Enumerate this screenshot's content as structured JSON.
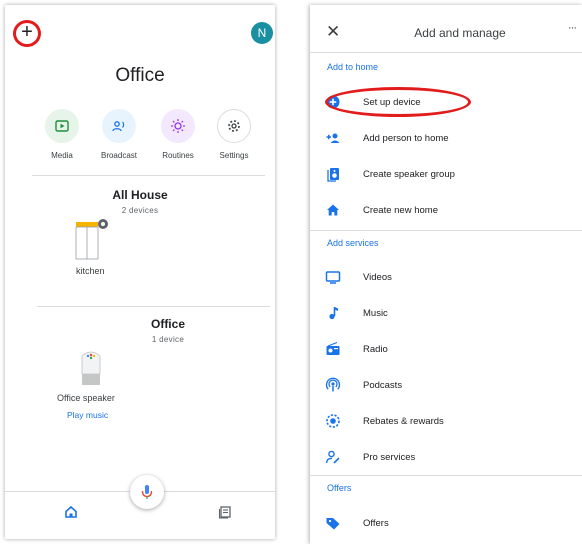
{
  "left_screen": {
    "add_icon": "plus-icon",
    "avatar_letter": "N",
    "home_title": "Office",
    "actions": [
      {
        "label": "Media",
        "icon": "media-play-icon",
        "bg": "#e6f4ea",
        "color": "#1e8e3e"
      },
      {
        "label": "Broadcast",
        "icon": "broadcast-icon",
        "bg": "#e8f4fd",
        "color": "#1a73e8"
      },
      {
        "label": "Routines",
        "icon": "routines-sun-icon",
        "bg": "#f3e8fd",
        "color": "#9334e6"
      },
      {
        "label": "Settings",
        "icon": "gear-icon",
        "bg": "#ffffff",
        "color": "#3c4043"
      }
    ],
    "groups": [
      {
        "title": "All House",
        "subtitle": "2 devices",
        "device_label": "kitchen",
        "device_icon": "speaker-group-icon"
      },
      {
        "title": "Office",
        "subtitle": "1 device",
        "device_label": "Office speaker",
        "device_icon": "google-home-speaker-icon",
        "link": "Play music"
      }
    ],
    "nav": [
      "home-icon",
      "feed-icon"
    ],
    "mic_icon": "mic-icon",
    "colors": {
      "accent": "#1a73e8",
      "annotation_red": "#e21b1b",
      "avatar": "#1a8fa2"
    }
  },
  "right_screen": {
    "close_icon": "✕",
    "title": "Add and manage",
    "more_icon": "···",
    "sections": [
      {
        "header": "Add to home",
        "items": [
          {
            "label": "Set up device",
            "icon": "add-device-icon"
          },
          {
            "label": "Add person to home",
            "icon": "add-person-icon"
          },
          {
            "label": "Create speaker group",
            "icon": "speaker-group-icon"
          },
          {
            "label": "Create new home",
            "icon": "home-icon"
          }
        ]
      },
      {
        "header": "Add services",
        "items": [
          {
            "label": "Videos",
            "icon": "tv-icon"
          },
          {
            "label": "Music",
            "icon": "music-note-icon"
          },
          {
            "label": "Radio",
            "icon": "radio-icon"
          },
          {
            "label": "Podcasts",
            "icon": "podcast-icon"
          },
          {
            "label": "Rebates & rewards",
            "icon": "rewards-icon"
          },
          {
            "label": "Pro services",
            "icon": "pro-services-icon"
          }
        ]
      },
      {
        "header": "Offers",
        "items": [
          {
            "label": "Offers",
            "icon": "tag-icon"
          }
        ]
      }
    ]
  }
}
